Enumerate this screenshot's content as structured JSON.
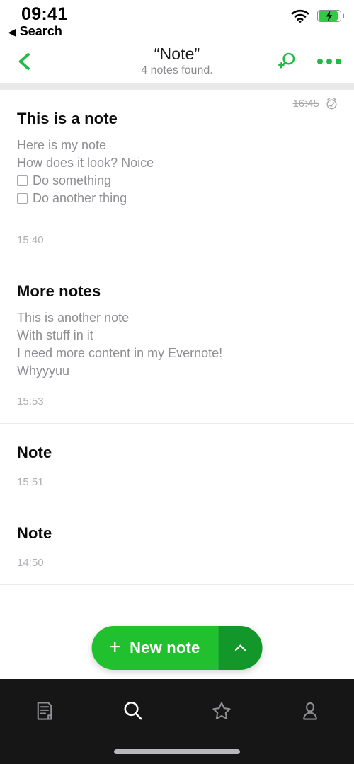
{
  "status_bar": {
    "time": "09:41",
    "back_app_label": "Search",
    "back_triangle": "◀",
    "wifi_icon": "wifi-icon",
    "battery_icon": "battery-charging-icon"
  },
  "nav_bar": {
    "back_icon": "chevron-left-icon",
    "title": "“Note”",
    "subtitle": "4 notes found.",
    "search_add_icon": "search-plus-icon",
    "more_icon": "more-options-icon"
  },
  "colors": {
    "accent_green": "#21ba45",
    "fab_green": "#21c02f",
    "fab_dark_green": "#13962a",
    "tabbar_dark": "#161617",
    "muted_text": "#8e8e93"
  },
  "notes": [
    {
      "title": "This is a note",
      "reminder_time": "16:45",
      "reminder_done": true,
      "reminder_icon": "alarm-clock-icon",
      "lines": [
        {
          "text": "Here is my note",
          "checkbox": false
        },
        {
          "text": "How does it look? Noice",
          "checkbox": false
        },
        {
          "text": "Do something",
          "checkbox": true
        },
        {
          "text": "Do another thing",
          "checkbox": true
        }
      ],
      "time": "15:40"
    },
    {
      "title": "More notes",
      "reminder_time": "",
      "reminder_done": false,
      "lines": [
        {
          "text": "This is another note",
          "checkbox": false
        },
        {
          "text": "With stuff in it",
          "checkbox": false
        },
        {
          "text": "I need more content in my Evernote!",
          "checkbox": false
        },
        {
          "text": "Whyyyuu",
          "checkbox": false
        }
      ],
      "time": "15:53"
    },
    {
      "title": "Note",
      "reminder_time": "",
      "reminder_done": false,
      "lines": [],
      "time": "15:51"
    },
    {
      "title": "Note",
      "reminder_time": "",
      "reminder_done": false,
      "lines": [],
      "time": "14:50"
    }
  ],
  "fab": {
    "plus": "+",
    "label": "New note",
    "expand_icon": "chevron-up-icon"
  },
  "tab_bar": {
    "items": [
      {
        "icon": "notes-icon",
        "active": false
      },
      {
        "icon": "search-icon",
        "active": true
      },
      {
        "icon": "star-icon",
        "active": false
      },
      {
        "icon": "profile-icon",
        "active": false
      }
    ],
    "home_indicator": "home-indicator"
  }
}
